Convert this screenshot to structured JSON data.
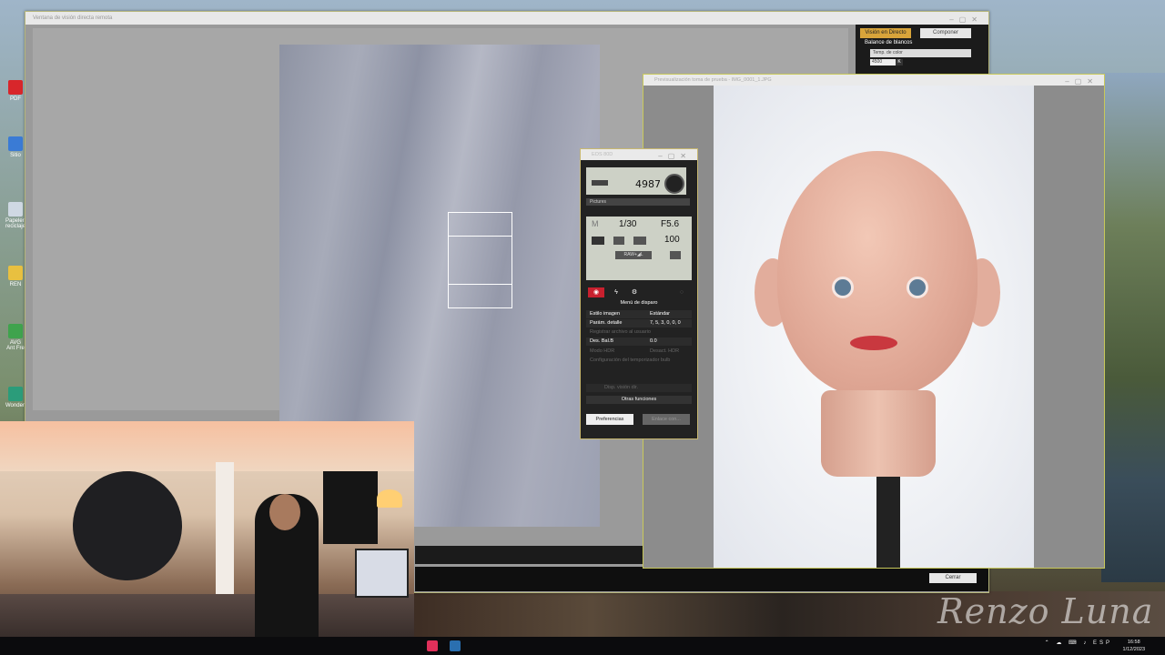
{
  "main_window": {
    "title": "Ventana de visión directa remota",
    "panel": {
      "live_view_button": "Visión en Directo",
      "compose_button": "Componer",
      "white_balance_label": "Balance de blancos",
      "wb_select": "Temp. de color",
      "wb_value": "4500",
      "wb_unit": "K"
    },
    "close_button": "Cerrar"
  },
  "preview_window": {
    "title": "Previsualización toma de prueba - IMG_0001_1.JPG"
  },
  "eos_panel": {
    "title": "EOS 80D",
    "shots_remaining": "4987",
    "pictures_label": "Pictures",
    "mode": "M",
    "shutter": "1/30",
    "aperture": "F5.6",
    "iso": "100",
    "raw_label": "RAW+◢L",
    "menu_title": "Menú de disparo",
    "rows": [
      {
        "label": "Estilo imagen",
        "value": "Estándar"
      },
      {
        "label": "Parám. detalle",
        "value": "7, 5, 3, 0, 0, 0"
      },
      {
        "label": "Registrar archivo al usuario",
        "value": ""
      },
      {
        "label": "Des. Bal.B",
        "value": "0.0"
      },
      {
        "label": "Modo HDR",
        "value": "Desact. HDR"
      },
      {
        "label": "Configuración del temporizador bulb",
        "value": ""
      }
    ],
    "disabled_control": "Disp. visión dir.",
    "other_functions": "Otras funciones",
    "preferences_button": "Preferencias",
    "second_button": "Enlace con..."
  },
  "desktop_icons": [
    {
      "label": "PDF",
      "color": "#d8262b"
    },
    {
      "label": "Sitio",
      "color": "#3a7bd5"
    },
    {
      "label": "Papelera reciclaje",
      "color": "#cfd8e3"
    },
    {
      "label": "REN",
      "color": "#e8c040"
    },
    {
      "label": "AVG Ant Fre",
      "color": "#3fa34d"
    },
    {
      "label": "Wonders",
      "color": "#2b9c7a"
    }
  ],
  "watermark": "Renzo Luna",
  "taskbar": {
    "lang": "ESP",
    "time": "16:58",
    "date": "1/12/2023"
  }
}
